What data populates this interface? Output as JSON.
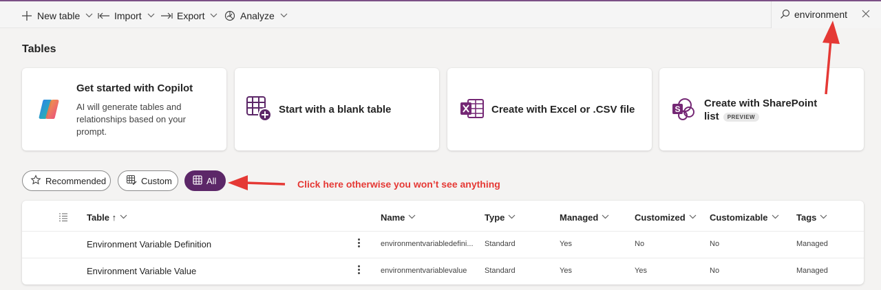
{
  "toolbar": {
    "new_table": "New table",
    "import": "Import",
    "export": "Export",
    "analyze": "Analyze",
    "search_value": "environment"
  },
  "page": {
    "title": "Tables"
  },
  "cards": [
    {
      "title": "Get started with Copilot",
      "desc": "AI will generate tables and relationships based on your prompt."
    },
    {
      "title": "Start with a blank table"
    },
    {
      "title": "Create with Excel or .CSV file"
    },
    {
      "title_line1": "Create with SharePoint",
      "title_line2": "list",
      "badge": "PREVIEW"
    }
  ],
  "filters": {
    "recommended": "Recommended",
    "custom": "Custom",
    "all": "All"
  },
  "annotation": {
    "text": "Click here otherwise you won’t see anything",
    "color": "#e53935"
  },
  "table": {
    "columns": {
      "table": "Table ↑",
      "name": "Name",
      "type": "Type",
      "managed": "Managed",
      "customized": "Customized",
      "customizable": "Customizable",
      "tags": "Tags"
    },
    "rows": [
      {
        "table": "Environment Variable Definition",
        "name": "environmentvariabledefini...",
        "type": "Standard",
        "managed": "Yes",
        "customized": "No",
        "customizable": "No",
        "tags": "Managed"
      },
      {
        "table": "Environment Variable Value",
        "name": "environmentvariablevalue",
        "type": "Standard",
        "managed": "Yes",
        "customized": "Yes",
        "customizable": "No",
        "tags": "Managed"
      }
    ]
  },
  "colors": {
    "accent": "#5c2768",
    "brand_border": "#7b4f86",
    "excel": "#742774"
  }
}
